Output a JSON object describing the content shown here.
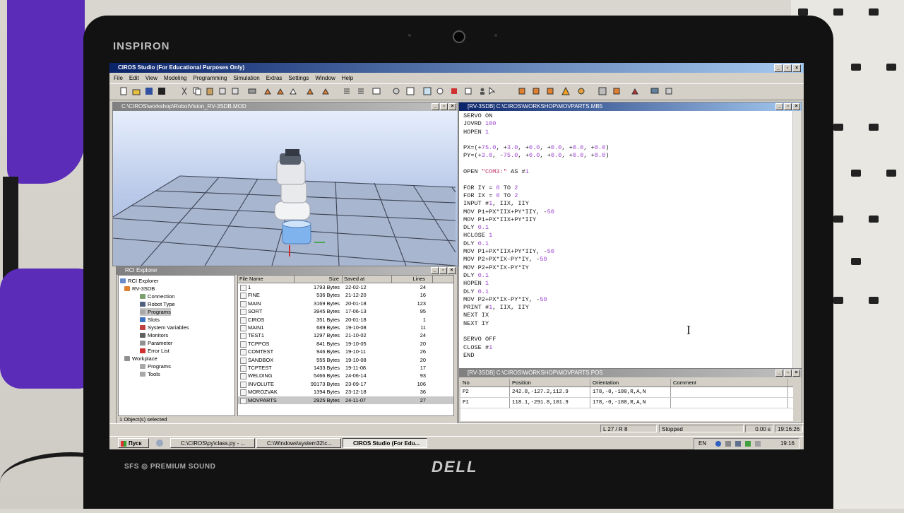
{
  "laptop": {
    "brand": "INSPIRON",
    "sound_label": "SFS ◎ PREMIUM SOUND",
    "logo": "DELL"
  },
  "app": {
    "title": "CIROS Studio (For Educational Purposes Only)",
    "menu": [
      "File",
      "Edit",
      "View",
      "Modeling",
      "Programming",
      "Simulation",
      "Extras",
      "Settings",
      "Window",
      "Help"
    ]
  },
  "view3d": {
    "title": "C:\\CIROS\\workshop\\RobotVision_RV-3SDB.MOD"
  },
  "editor": {
    "title": "[RV-3SDB] C:\\CIROS\\WORKSHOP\\MOVPARTS.MB5"
  },
  "explorer": {
    "title": "RCI Explorer",
    "tree": {
      "root": "RCI Explorer",
      "robot": "RV-3SDB",
      "connection": "Connection",
      "robot_type": "Robot Type",
      "programs": "Programs",
      "slots": "Slots",
      "system_variables": "System Variables",
      "monitors": "Monitors",
      "parameter": "Parameter",
      "error_list": "Error List",
      "workplace": "Workplace",
      "wp_programs": "Programs",
      "wp_tools": "Tools"
    },
    "columns": {
      "name": "File Name",
      "size": "Size",
      "saved": "Saved at",
      "lines": "Lines"
    },
    "files": [
      {
        "name": "1",
        "size": "1793 Bytes",
        "saved": "22-02-12",
        "lines": "24"
      },
      {
        "name": "FINE",
        "size": "536 Bytes",
        "saved": "21-12-20",
        "lines": "16"
      },
      {
        "name": "MAIN",
        "size": "3169 Bytes",
        "saved": "20-01-18",
        "lines": "123"
      },
      {
        "name": "SORT",
        "size": "3945 Bytes",
        "saved": "17-06-13",
        "lines": "95"
      },
      {
        "name": "CIROS",
        "size": "351 Bytes",
        "saved": "20-01-18",
        "lines": "1"
      },
      {
        "name": "MAIN1",
        "size": "689 Bytes",
        "saved": "19-10-08",
        "lines": "11"
      },
      {
        "name": "TEST1",
        "size": "1297 Bytes",
        "saved": "21-10-02",
        "lines": "24"
      },
      {
        "name": "TCPPOS",
        "size": "841 Bytes",
        "saved": "19-10-05",
        "lines": "20"
      },
      {
        "name": "COMTEST",
        "size": "946 Bytes",
        "saved": "19-10-11",
        "lines": "26"
      },
      {
        "name": "SANDBOX",
        "size": "555 Bytes",
        "saved": "19-10-08",
        "lines": "20"
      },
      {
        "name": "TCPTEST",
        "size": "1433 Bytes",
        "saved": "19-11-08",
        "lines": "17"
      },
      {
        "name": "WELDING",
        "size": "5466 Bytes",
        "saved": "24-06-14",
        "lines": "93"
      },
      {
        "name": "INVOLUTE",
        "size": "99173 Bytes",
        "saved": "23-09-17",
        "lines": "106"
      },
      {
        "name": "MOROZVAK",
        "size": "1394 Bytes",
        "saved": "23-12-18",
        "lines": "36"
      },
      {
        "name": "MOVPARTS",
        "size": "2925 Bytes",
        "saved": "24-11-07",
        "lines": "27"
      }
    ],
    "status": "1 Object(s) selected"
  },
  "positions": {
    "title": "[RV-3SDB] C:\\CIROS\\WORKSHOP\\MOVPARTS.POS",
    "columns": {
      "no": "No",
      "position": "Position",
      "orientation": "Orientation",
      "comment": "Comment"
    },
    "rows": [
      {
        "no": "P2",
        "position": "242.8,-127.2,112.9",
        "orientation": "178,-0,-180,R,A,N",
        "comment": ""
      },
      {
        "no": "P1",
        "position": "118.1,-291.8,101.9",
        "orientation": "178,-0,-180,R,A,N",
        "comment": ""
      }
    ]
  },
  "statusbar": {
    "cursor": "L 27 / R 8",
    "state": "Stopped",
    "time_elapsed": "0.00 s",
    "clock": "19:16:26"
  },
  "taskbar": {
    "start": "Пуск",
    "tasks": [
      "C:\\CIROS\\py\\class.py - ...",
      "C:\\Windows\\system32\\c...",
      "CIROS Studio (For Edu..."
    ],
    "lang": "EN",
    "time": "19:16"
  },
  "colors": {
    "title_active": "#0a246a",
    "title_gradient_end": "#a6caf0",
    "keyword": "#1a1a1a",
    "number": "#9a3fd0",
    "string": "#c0306a"
  }
}
